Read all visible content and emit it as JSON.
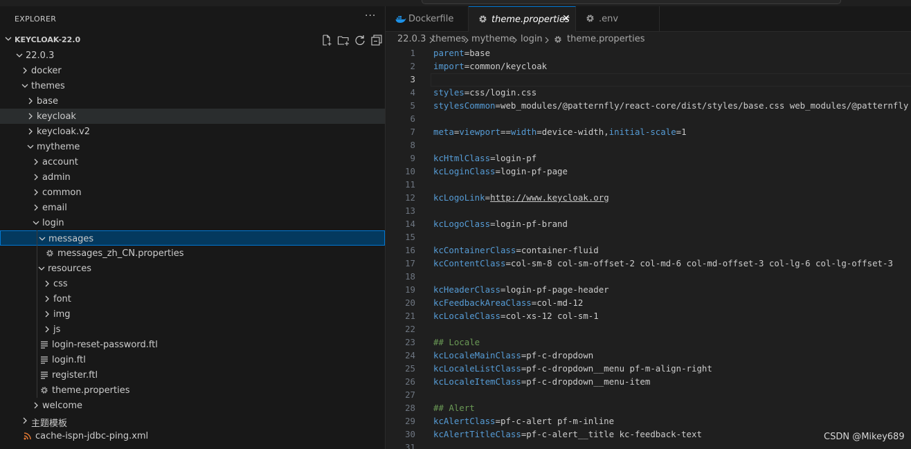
{
  "explorer": {
    "title": "EXPLORER",
    "more_label": "···",
    "workspace": "KEYCLOAK-22.0"
  },
  "tree": [
    {
      "label": "22.0.3",
      "type": "folder",
      "expanded": true,
      "depth": 1
    },
    {
      "label": "docker",
      "type": "folder",
      "expanded": false,
      "depth": 2
    },
    {
      "label": "themes",
      "type": "folder",
      "expanded": true,
      "depth": 2
    },
    {
      "label": "base",
      "type": "folder",
      "expanded": false,
      "depth": 3
    },
    {
      "label": "keycloak",
      "type": "folder",
      "expanded": false,
      "depth": 3,
      "state": "hover"
    },
    {
      "label": "keycloak.v2",
      "type": "folder",
      "expanded": false,
      "depth": 3
    },
    {
      "label": "mytheme",
      "type": "folder",
      "expanded": true,
      "depth": 3
    },
    {
      "label": "account",
      "type": "folder",
      "expanded": false,
      "depth": 4
    },
    {
      "label": "admin",
      "type": "folder",
      "expanded": false,
      "depth": 4
    },
    {
      "label": "common",
      "type": "folder",
      "expanded": false,
      "depth": 4
    },
    {
      "label": "email",
      "type": "folder",
      "expanded": false,
      "depth": 4
    },
    {
      "label": "login",
      "type": "folder",
      "expanded": true,
      "depth": 4
    },
    {
      "label": "messages",
      "type": "folder",
      "expanded": true,
      "depth": 5,
      "state": "selected"
    },
    {
      "label": "messages_zh_CN.properties",
      "type": "gear-file",
      "depth": 6
    },
    {
      "label": "resources",
      "type": "folder",
      "expanded": true,
      "depth": 5
    },
    {
      "label": "css",
      "type": "folder",
      "expanded": false,
      "depth": 6
    },
    {
      "label": "font",
      "type": "folder",
      "expanded": false,
      "depth": 6
    },
    {
      "label": "img",
      "type": "folder",
      "expanded": false,
      "depth": 6
    },
    {
      "label": "js",
      "type": "folder",
      "expanded": false,
      "depth": 6
    },
    {
      "label": "login-reset-password.ftl",
      "type": "text-file",
      "depth": 5
    },
    {
      "label": "login.ftl",
      "type": "text-file",
      "depth": 5
    },
    {
      "label": "register.ftl",
      "type": "text-file",
      "depth": 5
    },
    {
      "label": "theme.properties",
      "type": "gear-file",
      "depth": 5
    },
    {
      "label": "welcome",
      "type": "folder",
      "expanded": false,
      "depth": 4
    },
    {
      "label": "主题模板",
      "type": "folder",
      "expanded": false,
      "depth": 2
    },
    {
      "label": "cache-ispn-jdbc-ping.xml",
      "type": "rss-file",
      "depth": 2
    }
  ],
  "tabs": [
    {
      "label": "Dockerfile",
      "icon": "docker-icon",
      "active": false
    },
    {
      "label": "theme.properties",
      "icon": "gear-icon",
      "active": true,
      "close": "✕"
    },
    {
      "label": ".env",
      "icon": "gear-icon",
      "active": false
    }
  ],
  "breadcrumb": [
    "22.0.3",
    "themes",
    "mytheme",
    "login",
    "theme.properties"
  ],
  "code_lines": [
    {
      "n": "1",
      "key": "parent",
      "val": "=base"
    },
    {
      "n": "2",
      "key": "import",
      "val": "=common/keycloak"
    },
    {
      "n": "3",
      "key": "",
      "val": "",
      "current": true
    },
    {
      "n": "4",
      "key": "styles",
      "val": "=css/login.css"
    },
    {
      "n": "5",
      "key": "stylesCommon",
      "val": "=web_modules/@patternfly/react-core/dist/styles/base.css web_modules/@patternfly"
    },
    {
      "n": "6",
      "key": "",
      "val": ""
    },
    {
      "n": "7",
      "parts": [
        [
          "k",
          "meta"
        ],
        [
          "v",
          "="
        ],
        [
          "k",
          "viewport"
        ],
        [
          "v",
          "=="
        ],
        [
          "k",
          "width"
        ],
        [
          "v",
          "=device-width,"
        ],
        [
          "k",
          "initial-scale"
        ],
        [
          "v",
          "=1"
        ]
      ]
    },
    {
      "n": "8",
      "key": "",
      "val": ""
    },
    {
      "n": "9",
      "key": "kcHtmlClass",
      "val": "=login-pf"
    },
    {
      "n": "10",
      "key": "kcLoginClass",
      "val": "=login-pf-page"
    },
    {
      "n": "11",
      "key": "",
      "val": ""
    },
    {
      "n": "12",
      "parts": [
        [
          "k",
          "kcLogoLink"
        ],
        [
          "v",
          "="
        ],
        [
          "u",
          "http://www.keycloak.org"
        ]
      ]
    },
    {
      "n": "13",
      "key": "",
      "val": ""
    },
    {
      "n": "14",
      "key": "kcLogoClass",
      "val": "=login-pf-brand"
    },
    {
      "n": "15",
      "key": "",
      "val": ""
    },
    {
      "n": "16",
      "key": "kcContainerClass",
      "val": "=container-fluid"
    },
    {
      "n": "17",
      "key": "kcContentClass",
      "val": "=col-sm-8 col-sm-offset-2 col-md-6 col-md-offset-3 col-lg-6 col-lg-offset-3"
    },
    {
      "n": "18",
      "key": "",
      "val": ""
    },
    {
      "n": "19",
      "key": "kcHeaderClass",
      "val": "=login-pf-page-header"
    },
    {
      "n": "20",
      "key": "kcFeedbackAreaClass",
      "val": "=col-md-12"
    },
    {
      "n": "21",
      "key": "kcLocaleClass",
      "val": "=col-xs-12 col-sm-1"
    },
    {
      "n": "22",
      "key": "",
      "val": ""
    },
    {
      "n": "23",
      "comment": "## Locale"
    },
    {
      "n": "24",
      "key": "kcLocaleMainClass",
      "val": "=pf-c-dropdown"
    },
    {
      "n": "25",
      "key": "kcLocaleListClass",
      "val": "=pf-c-dropdown__menu pf-m-align-right"
    },
    {
      "n": "26",
      "key": "kcLocaleItemClass",
      "val": "=pf-c-dropdown__menu-item"
    },
    {
      "n": "27",
      "key": "",
      "val": ""
    },
    {
      "n": "28",
      "comment": "## Alert"
    },
    {
      "n": "29",
      "key": "kcAlertClass",
      "val": "=pf-c-alert pf-m-inline"
    },
    {
      "n": "30",
      "key": "kcAlertTitleClass",
      "val": "=pf-c-alert__title kc-feedback-text"
    },
    {
      "n": "31",
      "key": "",
      "val": ""
    }
  ],
  "watermark": "CSDN @Mikey689",
  "colors": {
    "accent": "#0078d4",
    "selection": "#04395e",
    "property_key": "#569cd6",
    "comment": "#6a9955"
  }
}
